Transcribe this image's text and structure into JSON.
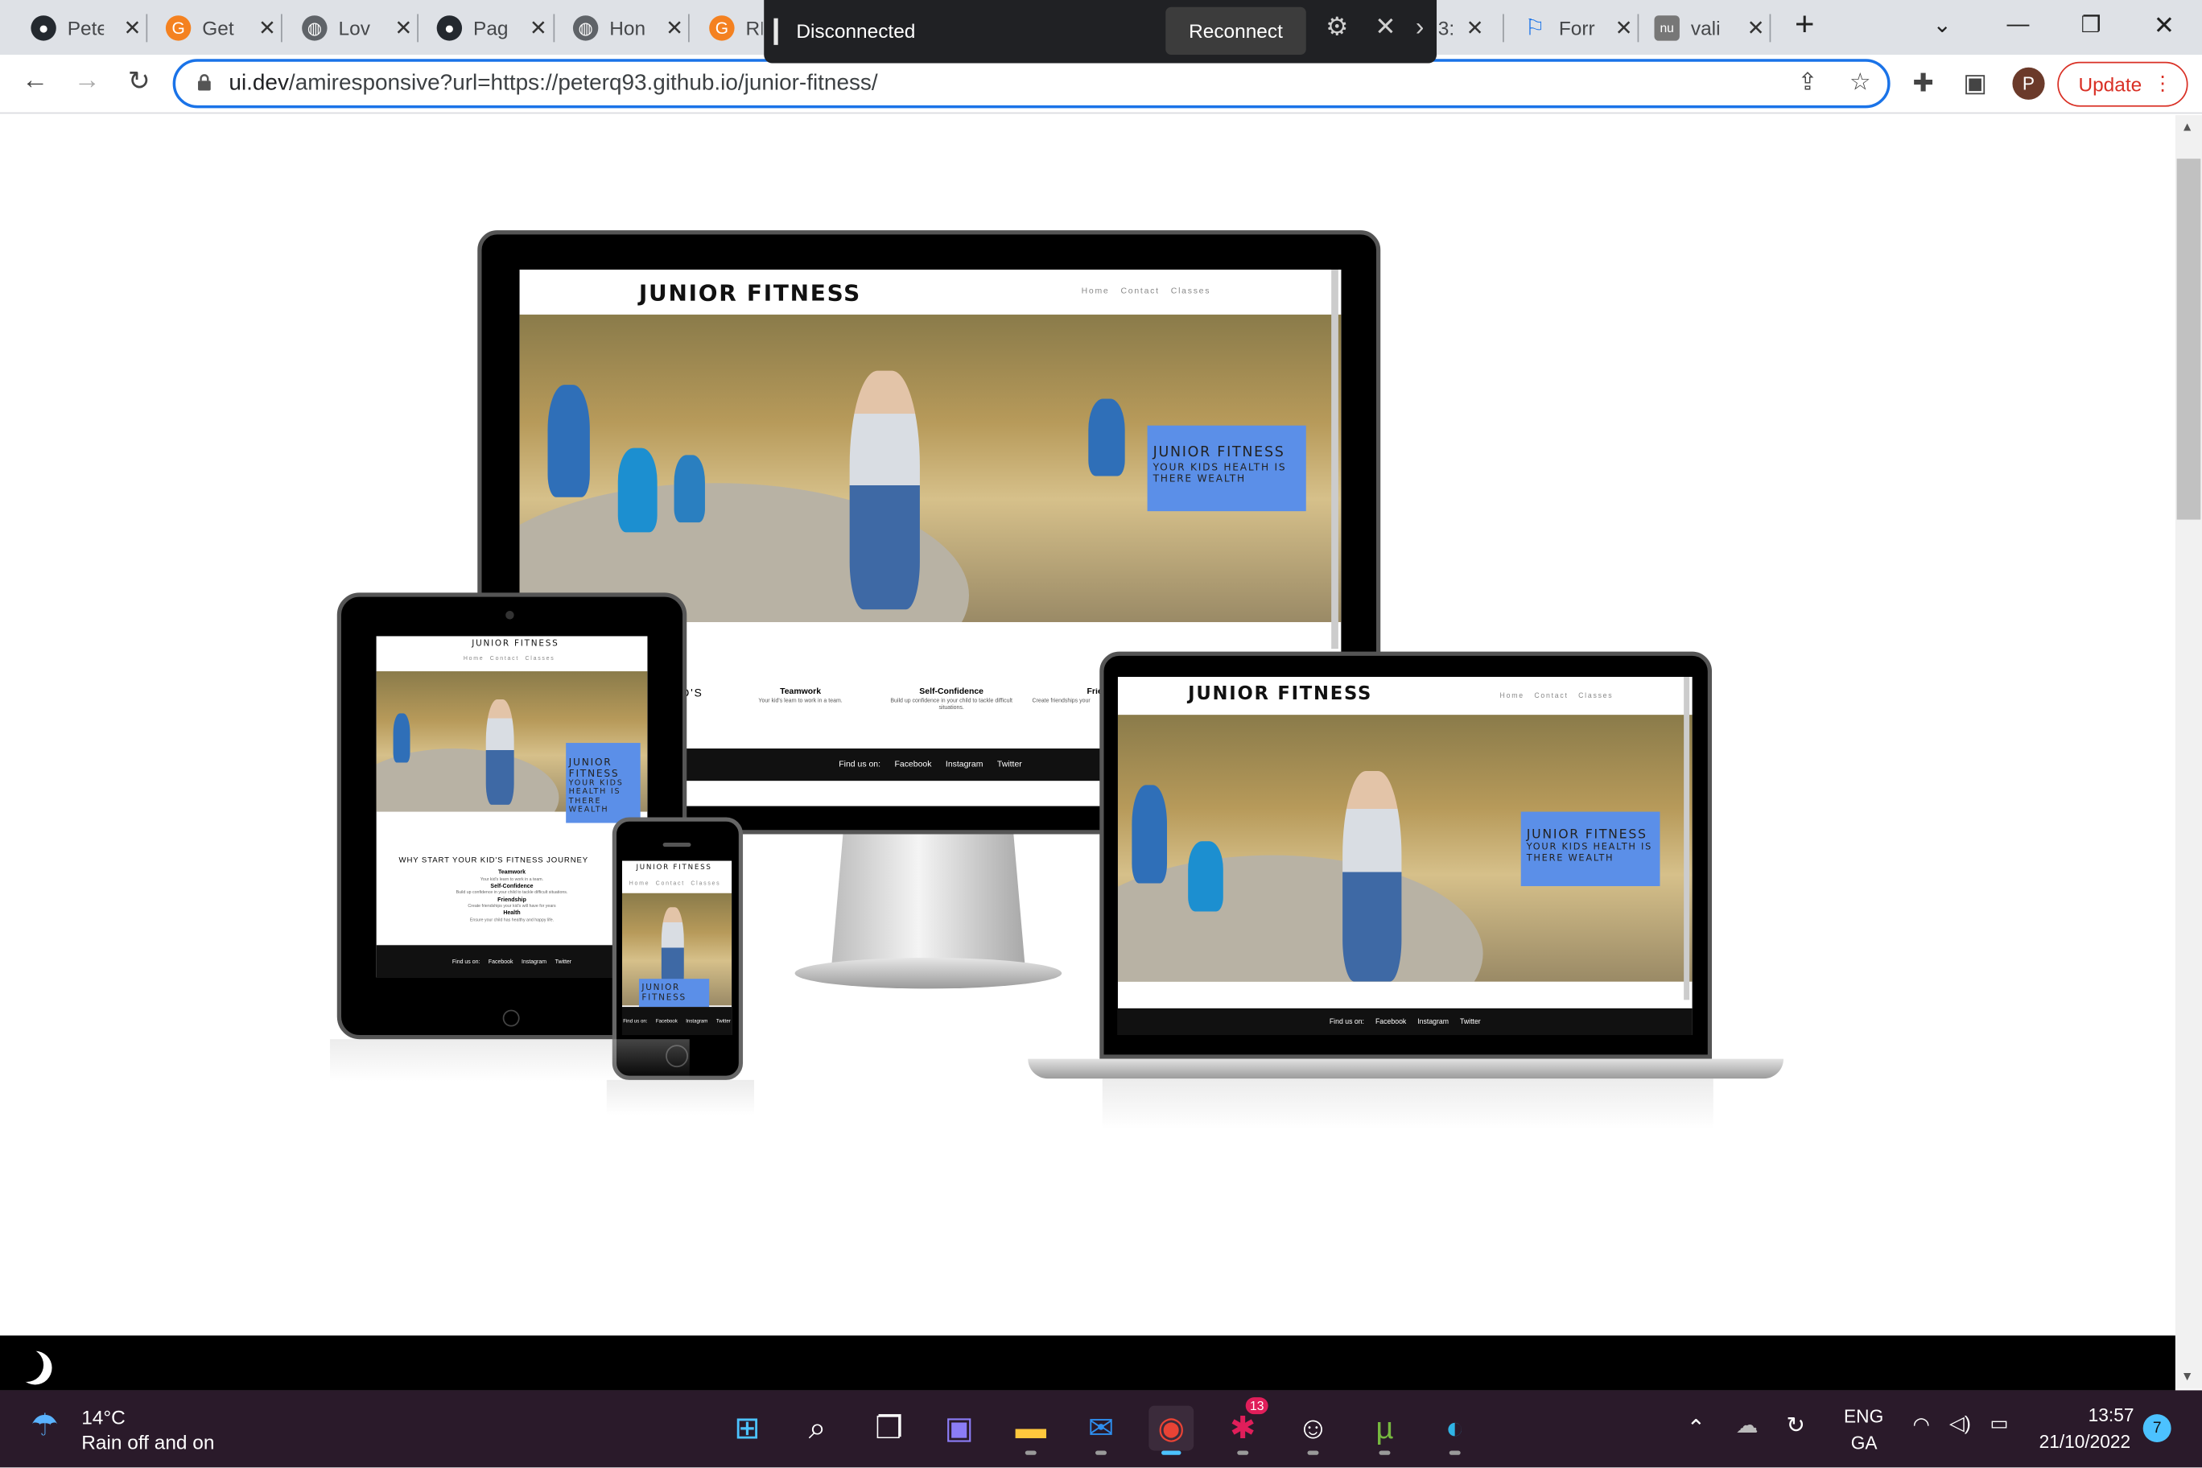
{
  "browser": {
    "tabs": [
      {
        "title": "Pete",
        "icon": "github-icon",
        "color": "#24292f"
      },
      {
        "title": "Get",
        "icon": "g-icon",
        "color": "#f48120"
      },
      {
        "title": "Lov",
        "icon": "globe-icon",
        "color": "#5f6368"
      },
      {
        "title": "Pag",
        "icon": "github-icon",
        "color": "#24292f"
      },
      {
        "title": "Hon",
        "icon": "globe-icon",
        "color": "#5f6368"
      },
      {
        "title": "RE",
        "icon": "g-icon",
        "color": "#f48120"
      },
      {
        "title": "3:",
        "icon": "tab-icon",
        "color": "#5f6368"
      },
      {
        "title": "Forr",
        "icon": "flag-icon",
        "color": "#1a73e8"
      },
      {
        "title": "vali",
        "icon": "nu-icon",
        "color": "#777"
      }
    ],
    "new_tab": "+",
    "url_host": "ui.dev",
    "url_rest": "/amiresponsive?url=https://peterq93.github.io/junior-fitness/",
    "profile_initial": "P",
    "update_label": "Update"
  },
  "toast": {
    "message": "Disconnected",
    "button": "Reconnect"
  },
  "site": {
    "brand": "JUNIOR FITNESS",
    "nav": [
      "Home",
      "Contact",
      "Classes"
    ],
    "cta_title": "JUNIOR FITNESS",
    "cta_sub": "YOUR KIDS HEALTH IS THERE WEALTH",
    "why_title": "WHY START YOUR KID'S FITNESS JOURNEY",
    "why_title_fragment": "D'S",
    "features": [
      {
        "title": "Teamwork",
        "text": "Your kid's learn to work in a team."
      },
      {
        "title": "Self-Confidence",
        "text": "Build up confidence in your child to tackle difficult situations."
      },
      {
        "title": "Friendship",
        "text": "Create friendships your kid's will have for years"
      },
      {
        "title": "Health",
        "text": "Ensure your child has healthy and happy life."
      }
    ],
    "feature_fragment_title": "Frie",
    "feature_fragment_text": "Create friendships your",
    "footer": {
      "find": "Find us on:",
      "facebook": "Facebook",
      "instagram": "Instagram",
      "twitter": "Twitter"
    }
  },
  "taskbar": {
    "weather_temp": "14°C",
    "weather_desc": "Rain off and on",
    "lang1": "ENG",
    "lang2": "GA",
    "time": "13:57",
    "date": "21/10/2022",
    "notif_count": "7",
    "slack_badge": "13"
  }
}
